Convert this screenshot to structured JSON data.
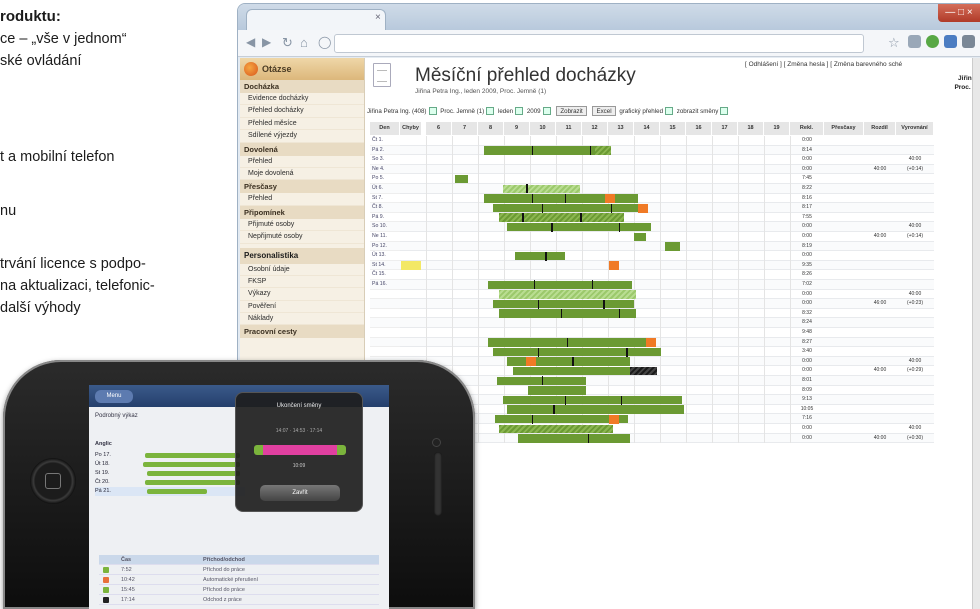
{
  "article": {
    "title": "roduktu:",
    "lines": [
      "ce – „vše v jednom“",
      "ské ovládání",
      "t a mobilní telefon",
      "nu",
      "trvání licence s podpo-",
      "na aktualizaci, telefonic-",
      "další výhody"
    ]
  },
  "browser": {
    "close_label": "×",
    "winctl_label": "— □ ×"
  },
  "sidebar": {
    "header": "Otázse",
    "sections": [
      {
        "title": "Docházka",
        "items": [
          "Evidence docházky",
          "Přehled docházky",
          "Přehled měsíce",
          "Sdílené výjezdy"
        ]
      },
      {
        "title": "Dovolená",
        "items": [
          "Přehled",
          "Moje dovolená"
        ]
      },
      {
        "title": "Přesčasy",
        "items": [
          "Přehled"
        ]
      },
      {
        "title": "Připomínek",
        "items": [
          "Přijmuté osoby",
          "Nepřijmuté osoby"
        ]
      }
    ],
    "big_section": "Personalistika",
    "big_items": [
      "Osobní údaje",
      "FKSP",
      "Výkazy",
      "Pověření",
      "Náklady"
    ],
    "last_section": "Pracovní cesty"
  },
  "page": {
    "title": "Měsíční přehled docházky",
    "subtitle": "Jiřina Petra Ing., leden 2009, Proc. Jemně (1)",
    "toplinks": "[ Odhlášení ] [ Změna hesla ] [ Změna barevného sché",
    "user_line1": "Jiřina I",
    "user_line2": "Proc. př",
    "filters": {
      "person": "Jiřina Petra Ing. (408)",
      "dept": "Proc. Jemně (1)",
      "month": "leden",
      "year": "2009",
      "btn_show": "Zobrazit",
      "btn_print": "Excel",
      "chk1": "grafický přehled",
      "chk2": "zobrazit směny"
    }
  },
  "table": {
    "headers": [
      "Den",
      "Chyby",
      "Rekl.",
      "Přesčasy",
      "Rozdíl",
      "Vyrovnání"
    ],
    "hours": [
      "6",
      "7",
      "8",
      "9",
      "10",
      "11",
      "12",
      "13",
      "14",
      "15",
      "16",
      "17",
      "18",
      "19"
    ],
    "days": [
      "Čt 1.",
      "Pá 2.",
      "So 3.",
      "Ne 4.",
      "Po 5.",
      "Út 6.",
      "St 7.",
      "Čt 8.",
      "Pá 9.",
      "So 10.",
      "Ne 11.",
      "Po 12.",
      "Út 13.",
      "St 14.",
      "Čt 15.",
      "Pá 16."
    ],
    "rekl": [
      "0:00",
      "8:14",
      "0:00",
      "0:00",
      "7:45",
      "8:22",
      "8:16",
      "8:17",
      "7:55",
      "0:00",
      "0:00",
      "8:19",
      "0:00",
      "9:35",
      "8:26",
      "7:02",
      "0:00",
      "0:00",
      "8:32",
      "8:24",
      "9:48",
      "8:27",
      "3:40",
      "0:00",
      "0:00",
      "8:01",
      "8:09",
      "9:13",
      "10:05",
      "7:16",
      "0:00",
      "0:00"
    ],
    "rozdil": [
      "",
      "",
      "",
      "40:00",
      "",
      "",
      "",
      "",
      "",
      "",
      "40:00",
      "",
      "",
      "",
      "",
      "",
      "",
      "46:00",
      "",
      "",
      "",
      "",
      "",
      "",
      "40:00",
      "",
      "",
      "",
      "",
      "",
      "",
      "40:00"
    ],
    "vyrov": [
      "",
      "",
      "40:00",
      "(+0:14)",
      "",
      "",
      "",
      "",
      "",
      "40:00",
      "(+0:14)",
      "",
      "",
      "",
      "",
      "",
      "40:00",
      "(+0:23)",
      "",
      "",
      "",
      "",
      "",
      "40:00",
      "(+0:29)",
      "",
      "",
      "",
      "",
      "",
      "40:00",
      "(+0:30)"
    ]
  },
  "phone": {
    "back": "Menu",
    "row_label": "Podrobný výkaz",
    "header_left": "Anglic",
    "days": [
      "Po 17.",
      "Út 18.",
      "St 19.",
      "Čt 20.",
      "Pá 21."
    ],
    "modal_title": "Ukončení směny",
    "modal_nums": "14:07 · 14:53 · 17:14",
    "modal_val": "10:09",
    "modal_btn": "Zavřít",
    "legend_header_time": "Čas",
    "legend_header_desc": "Příchod/odchod",
    "legend": [
      {
        "time": "7:52",
        "desc": "Příchod do práce",
        "color": "#7bb43c"
      },
      {
        "time": "10:42",
        "desc": "Automatické přerušení",
        "color": "#e8703a"
      },
      {
        "time": "15:45",
        "desc": "Příchod do práce",
        "color": "#7bb43c"
      },
      {
        "time": "17:14",
        "desc": "Odchod z práce",
        "color": "#222"
      }
    ]
  }
}
